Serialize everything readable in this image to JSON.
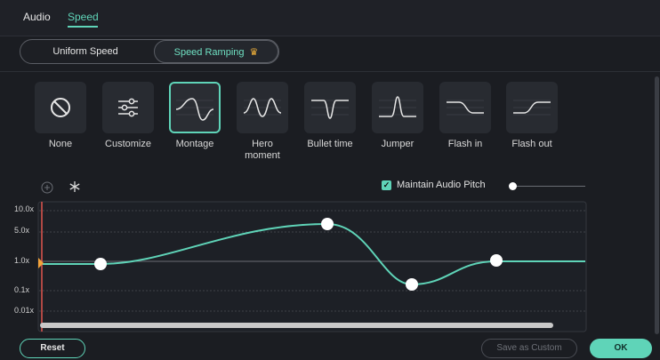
{
  "tabs": [
    {
      "label": "Audio",
      "active": false
    },
    {
      "label": "Speed",
      "active": true
    }
  ],
  "mode": {
    "uniform_label": "Uniform Speed",
    "ramping_label": "Speed Ramping",
    "selected": "Speed Ramping",
    "ramping_badge_icon": "crown-icon"
  },
  "presets": [
    {
      "label": "None",
      "icon": "no-symbol-icon"
    },
    {
      "label": "Customize",
      "icon": "sliders-icon"
    },
    {
      "label": "Montage",
      "icon": "montage-curve-icon",
      "selected": true
    },
    {
      "label": "Hero moment",
      "icon": "hero-moment-curve-icon"
    },
    {
      "label": "Bullet time",
      "icon": "bullet-time-curve-icon"
    },
    {
      "label": "Jumper",
      "icon": "jumper-curve-icon"
    },
    {
      "label": "Flash in",
      "icon": "flash-in-curve-icon"
    },
    {
      "label": "Flash out",
      "icon": "flash-out-curve-icon"
    }
  ],
  "graph_tools": [
    {
      "icon": "add-point-icon"
    },
    {
      "icon": "freeze-frame-icon"
    }
  ],
  "maintain_pitch": {
    "label": "Maintain Audio Pitch",
    "checked": true
  },
  "pitch_slider": {
    "value": 0.0
  },
  "speed_axis_labels": [
    "10.0x",
    "5.0x",
    "1.0x",
    "0.1x",
    "0.01x"
  ],
  "buttons": {
    "reset": "Reset",
    "save_custom": "Save as Custom",
    "ok": "OK"
  },
  "colors": {
    "accent": "#5fd4b8",
    "playhead": "#e0554f",
    "crown": "#f2b23a"
  }
}
